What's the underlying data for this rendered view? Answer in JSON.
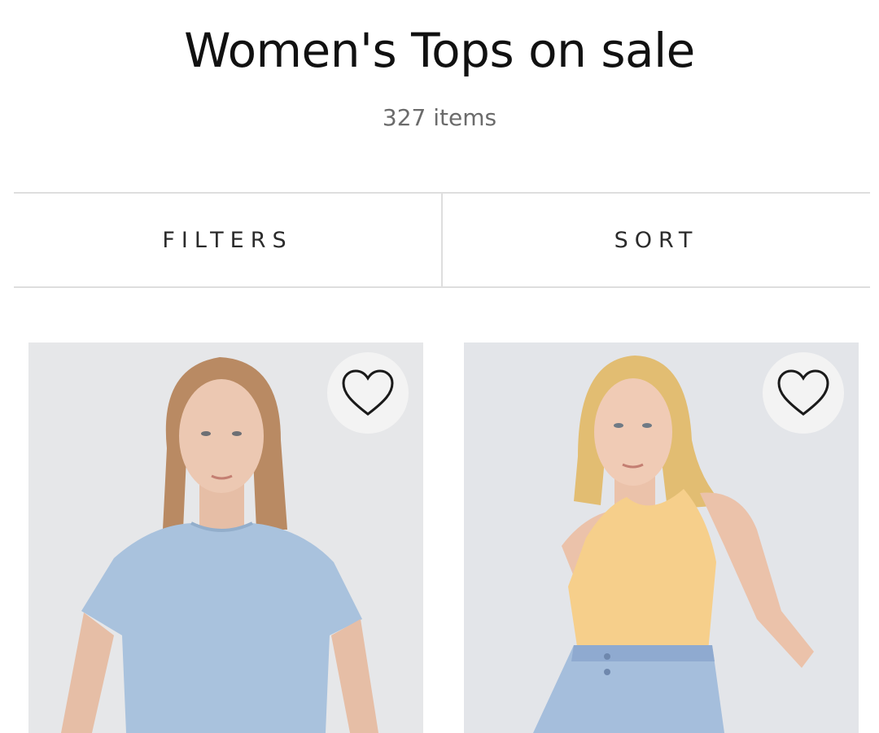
{
  "page": {
    "title": "Women's Tops on sale",
    "item_count": "327 items"
  },
  "toolbar": {
    "filters_label": "FILTERS",
    "sort_label": "SORT"
  },
  "products": [
    {
      "top_color": "#a9c2dd",
      "skin": "#e9c3ad",
      "hair": "#b98a63",
      "favorite_icon": "heart-outline-icon"
    },
    {
      "top_color": "#f6cf8b",
      "skin": "#efc8b1",
      "hair": "#e2bd72",
      "favorite_icon": "heart-outline-icon"
    }
  ]
}
